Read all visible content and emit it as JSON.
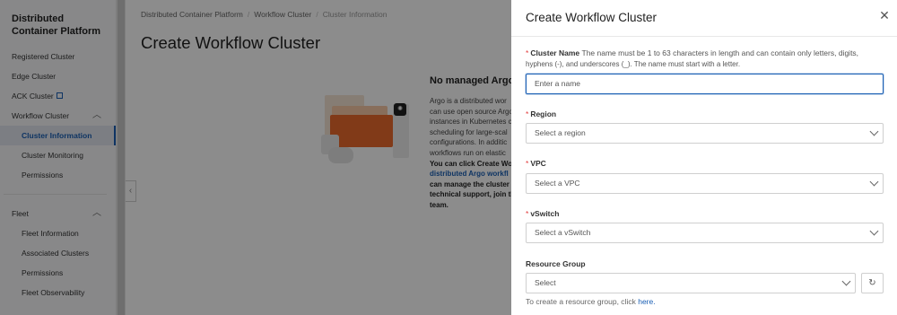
{
  "sidebar": {
    "title": "Distributed Container Platform",
    "items": [
      {
        "label": "Registered Cluster"
      },
      {
        "label": "Edge Cluster"
      },
      {
        "label": "ACK Cluster"
      },
      {
        "label": "Workflow Cluster"
      },
      {
        "label": "Cluster Information"
      },
      {
        "label": "Cluster Monitoring"
      },
      {
        "label": "Permissions"
      },
      {
        "label": "Fleet"
      },
      {
        "label": "Fleet Information"
      },
      {
        "label": "Associated Clusters"
      },
      {
        "label": "Permissions"
      },
      {
        "label": "Fleet Observability"
      }
    ]
  },
  "breadcrumb": {
    "items": [
      "Distributed Container Platform",
      "Workflow Cluster",
      "Cluster Information"
    ]
  },
  "page": {
    "title": "Create Workflow Cluster",
    "empty_title": "No managed Argo",
    "empty_desc_lines": [
      "Argo is a distributed wor",
      "can use open source Argo",
      "instances in Kubernetes c",
      "scheduling for large-scal",
      "configurations. In additic",
      "workflows run on elastic"
    ],
    "empty_bold_1": "You can click Create Wo",
    "empty_link": "distributed Argo workfl",
    "empty_bold_2": "can manage the cluster",
    "empty_bold_3": "technical support, join th",
    "empty_bold_4": "team."
  },
  "drawer": {
    "title": "Create Workflow Cluster",
    "cluster_name": {
      "label": "Cluster Name",
      "help": "The name must be 1 to 63 characters in length and can contain only letters, digits,",
      "help2": "hyphens (-), and underscores (_). The name must start with a letter.",
      "placeholder": "Enter a name"
    },
    "region": {
      "label": "Region",
      "value": "Select a region"
    },
    "vpc": {
      "label": "VPC",
      "value": "Select a VPC"
    },
    "vswitch": {
      "label": "vSwitch",
      "value": "Select a vSwitch"
    },
    "resource_group": {
      "label": "Resource Group",
      "value": "Select",
      "hint": "To create a resource group, click",
      "link": "here."
    }
  },
  "colors": {
    "accent": "#1a5fb4",
    "required": "#e23c3c",
    "illustration": "#ec6b2d"
  },
  "icons": [
    "external-link-icon",
    "chevron-up-icon",
    "chevron-left-icon",
    "argo-icon",
    "close-icon",
    "chevron-down-icon",
    "refresh-icon"
  ]
}
